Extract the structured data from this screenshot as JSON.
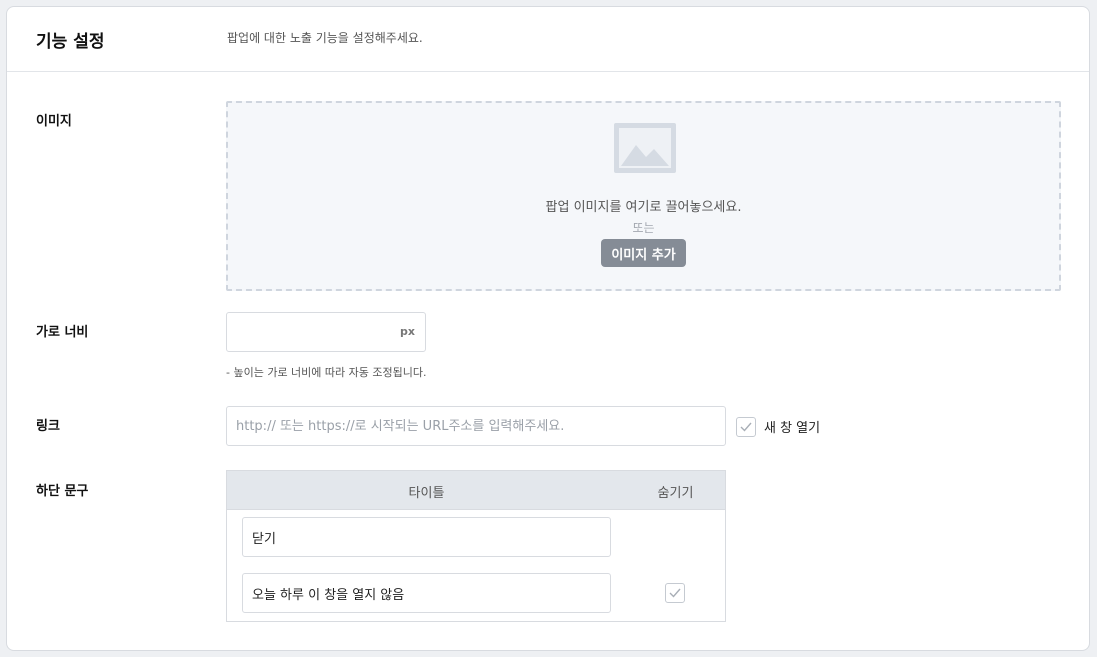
{
  "header": {
    "title": "기능 설정",
    "description": "팝업에 대한 노출 기능을 설정해주세요."
  },
  "image": {
    "label": "이미지",
    "drop_text": "팝업 이미지를 여기로 끌어놓으세요.",
    "or_text": "또는",
    "add_button": "이미지 추가"
  },
  "width": {
    "label": "가로 너비",
    "value": "",
    "unit": "px",
    "hint": "- 높이는 가로 너비에 따라 자동 조정됩니다."
  },
  "link": {
    "label": "링크",
    "placeholder": "http:// 또는 https://로 시작되는 URL주소를 입력해주세요.",
    "value": "",
    "new_window_label": "새 창 열기",
    "new_window_checked": false
  },
  "footer_text": {
    "label": "하단 문구",
    "columns": {
      "title": "타이틀",
      "hide": "숨기기"
    },
    "rows": [
      {
        "title": "닫기",
        "has_hide": false
      },
      {
        "title": "오늘 하루 이 창을 열지 않음",
        "has_hide": true,
        "hide_checked": false
      }
    ]
  },
  "colors": {
    "button_bg": "#858c96",
    "table_header_bg": "#e3e7ec",
    "dropzone_bg": "#f5f7fa"
  },
  "icons": {
    "image_placeholder": "image-placeholder-icon",
    "check": "check-icon"
  }
}
